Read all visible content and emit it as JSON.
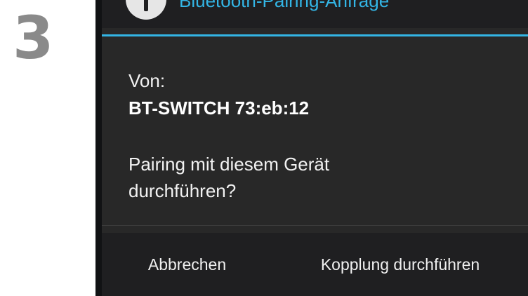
{
  "step": {
    "number": "3"
  },
  "dialog": {
    "title": "Bluetooth-Pairing-Anfrage",
    "from_label": "Von:",
    "device_name": "BT-SWITCH 73:eb:12",
    "question_line1": "Pairing mit diesem Gerät",
    "question_line2": "durchführen?",
    "cancel_label": "Abbrechen",
    "confirm_label": "Kopplung durchführen",
    "icon": "alert-icon"
  },
  "colors": {
    "accent": "#33b5e5",
    "dialog_background": "#282828",
    "button_bar_background": "#1f1f21"
  }
}
